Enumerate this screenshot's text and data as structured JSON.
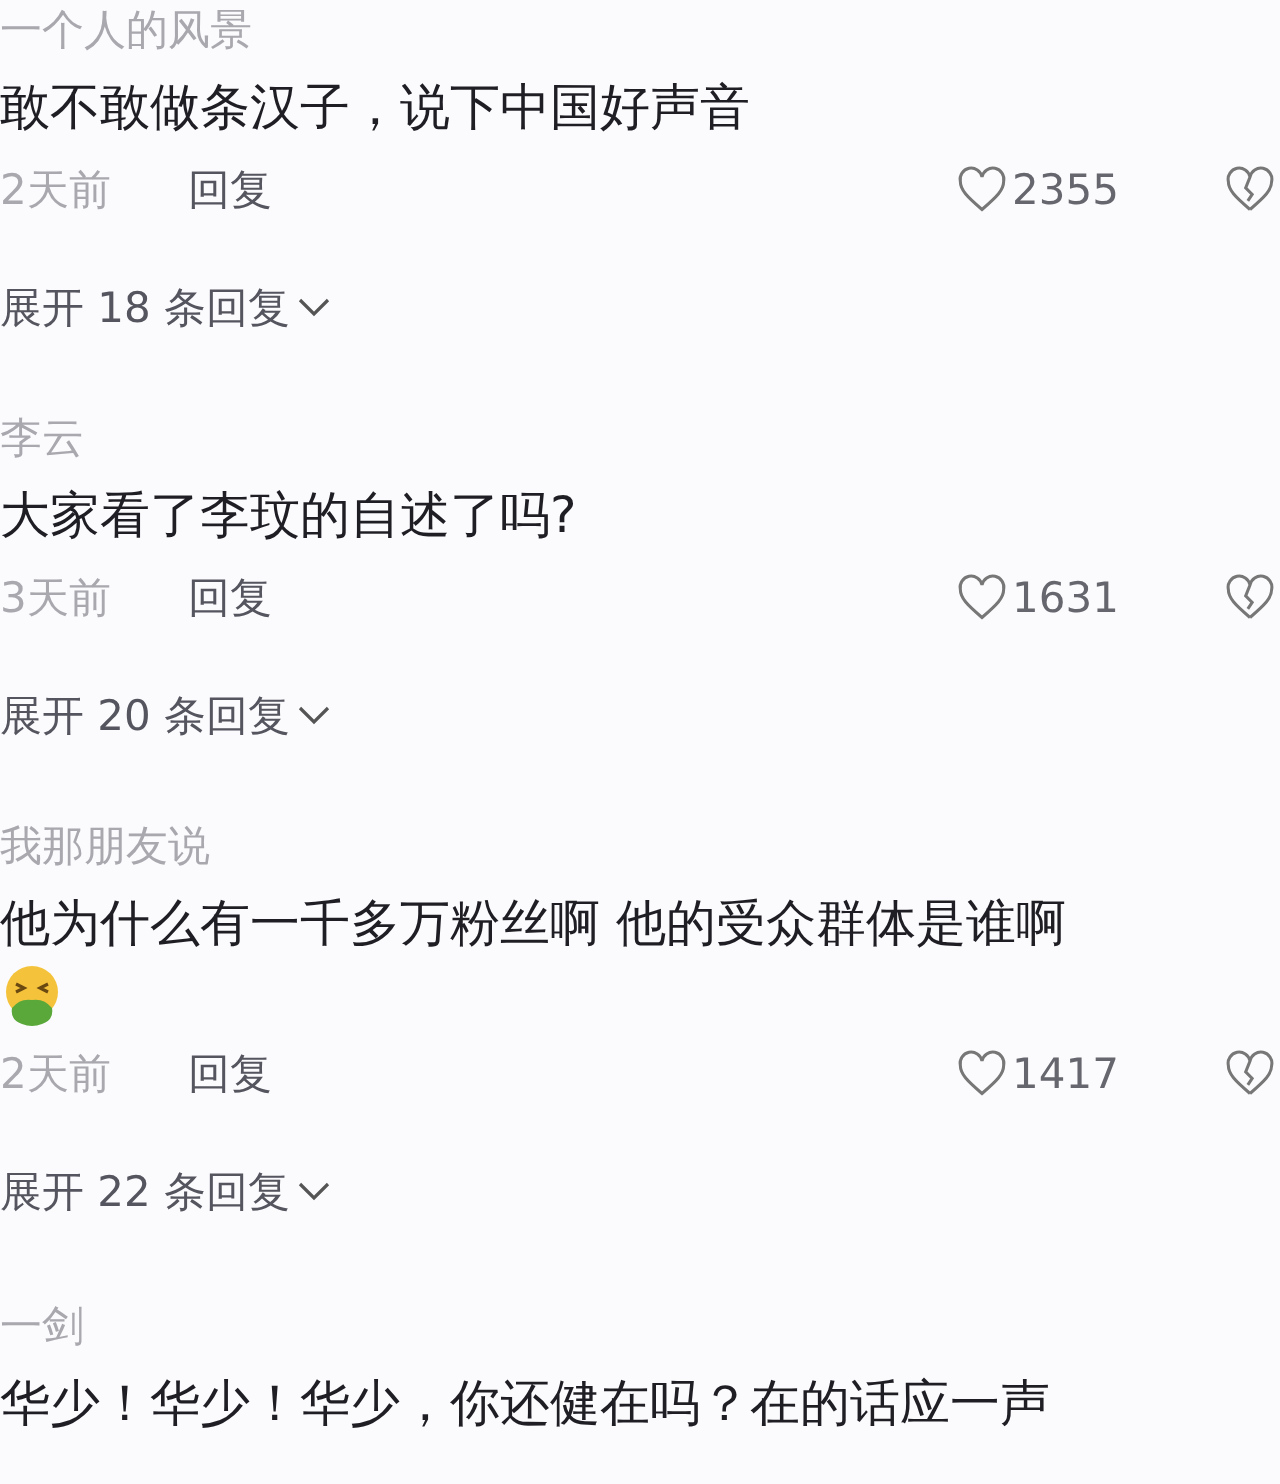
{
  "comments": [
    {
      "username": "一个人的风景",
      "text": "敢不敢做条汉子，说下中国好声音",
      "has_emoji": false,
      "time": "2天前",
      "reply": "回复",
      "likes": "2355",
      "expand": "展开 18 条回复"
    },
    {
      "username": "李云",
      "text": "大家看了李玟的自述了吗?",
      "has_emoji": false,
      "time": "3天前",
      "reply": "回复",
      "likes": "1631",
      "expand": "展开 20 条回复"
    },
    {
      "username": "我那朋友说",
      "text": "他为什么有一千多万粉丝啊 他的受众群体是谁啊",
      "has_emoji": true,
      "time": "2天前",
      "reply": "回复",
      "likes": "1417",
      "expand": "展开 22 条回复"
    },
    {
      "username": "一剑",
      "text": "华少！华少！华少，你还健在吗？在的话应一声"
    }
  ]
}
